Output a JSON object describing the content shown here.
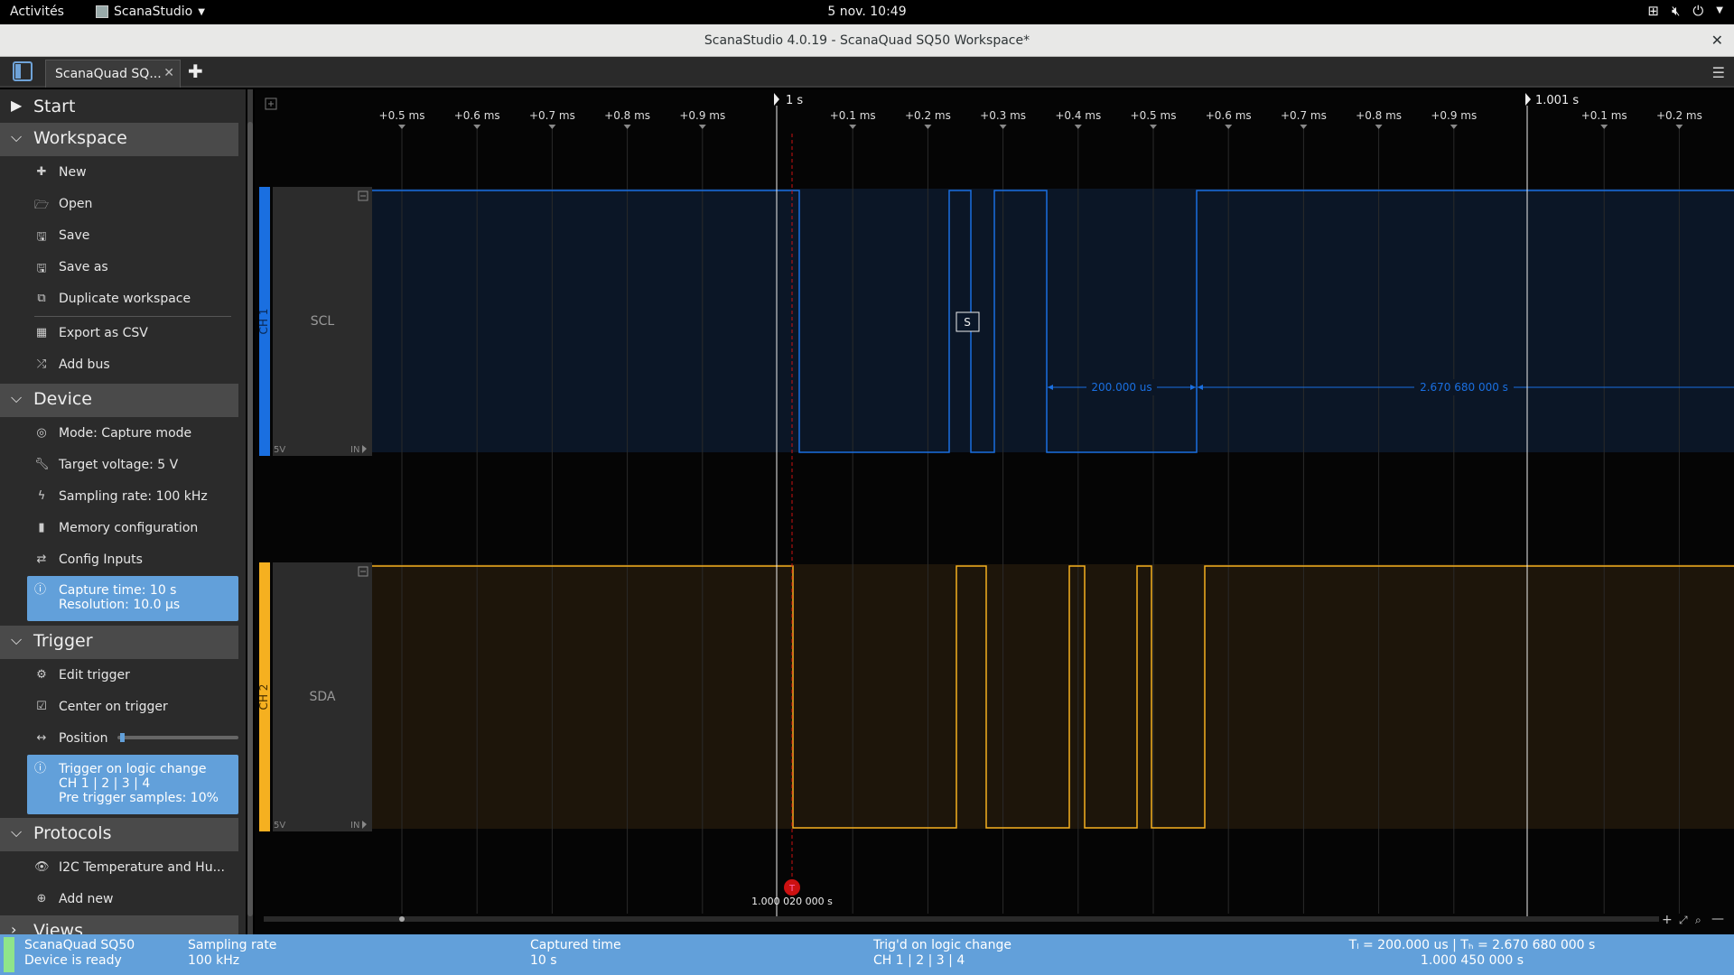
{
  "system": {
    "activities": "Activités",
    "app_name": "ScanaStudio",
    "clock": "5 nov.  10:49"
  },
  "window": {
    "title": "ScanaStudio 4.0.19 - ScanaQuad SQ50 Workspace*",
    "tab_label": "ScanaQuad SQ..."
  },
  "sidebar": {
    "start": "Start",
    "workspace": {
      "title": "Workspace",
      "items": [
        "New",
        "Open",
        "Save",
        "Save as",
        "Duplicate workspace",
        "Export as CSV",
        "Add bus"
      ]
    },
    "device": {
      "title": "Device",
      "items": [
        "Mode: Capture mode",
        "Target voltage: 5 V",
        "Sampling rate: 100 kHz",
        "Memory configuration",
        "Config Inputs"
      ],
      "info_line1": "Capture time: 10 s",
      "info_line2": "Resolution: 10.0 µs"
    },
    "trigger": {
      "title": "Trigger",
      "items": [
        "Edit trigger",
        "Center on trigger",
        "Position"
      ],
      "position_fraction": 0.02,
      "info_line1": "Trigger on logic change",
      "info_line2": "CH 1 | 2 | 3 | 4",
      "info_line3": "Pre trigger samples: 10%"
    },
    "protocols": {
      "title": "Protocols",
      "items": [
        "I2C Temperature and Hu...",
        "Add new"
      ]
    },
    "views": {
      "title": "Views"
    }
  },
  "timeline": {
    "marker1": "1 s",
    "marker2": "1.001 s",
    "ticks": [
      "+0.5 ms",
      "+0.6 ms",
      "+0.7 ms",
      "+0.8 ms",
      "+0.9 ms",
      "+0.1 ms",
      "+0.2 ms",
      "+0.3 ms",
      "+0.4 ms",
      "+0.5 ms",
      "+0.6 ms",
      "+0.7 ms",
      "+0.8 ms",
      "+0.9 ms",
      "+0.1 ms",
      "+0.2 ms"
    ]
  },
  "channels": [
    {
      "id": "CH 1",
      "name": "SCL",
      "voltage": "5V",
      "io": "IN",
      "color": "#1a6fe0"
    },
    {
      "id": "CH 2",
      "name": "SDA",
      "voltage": "5V",
      "io": "IN",
      "color": "#f5b020"
    }
  ],
  "measure": {
    "low_label": "200.000 us",
    "high_label": "2.670 680 000 s",
    "start_label": "S"
  },
  "trigger_marker": {
    "label": "T",
    "time": "1.000 020 000 s"
  },
  "status": {
    "device_name": "ScanaQuad SQ50",
    "device_state": "Device is ready",
    "sampling_label": "Sampling rate",
    "sampling_value": "100 kHz",
    "captured_label": "Captured time",
    "captured_value": "10 s",
    "trig_label": "Trig'd on logic change",
    "trig_value": "CH 1 | 2 | 3 | 4",
    "tl_th": "Tₗ = 200.000 us | Tₕ = 2.670 680 000 s",
    "measure_time": "1.000 450 000 s"
  },
  "colors": {
    "accent": "#62a0da",
    "scl": "#1a6fe0",
    "sda": "#f5b020",
    "trigger": "#cc1111"
  }
}
